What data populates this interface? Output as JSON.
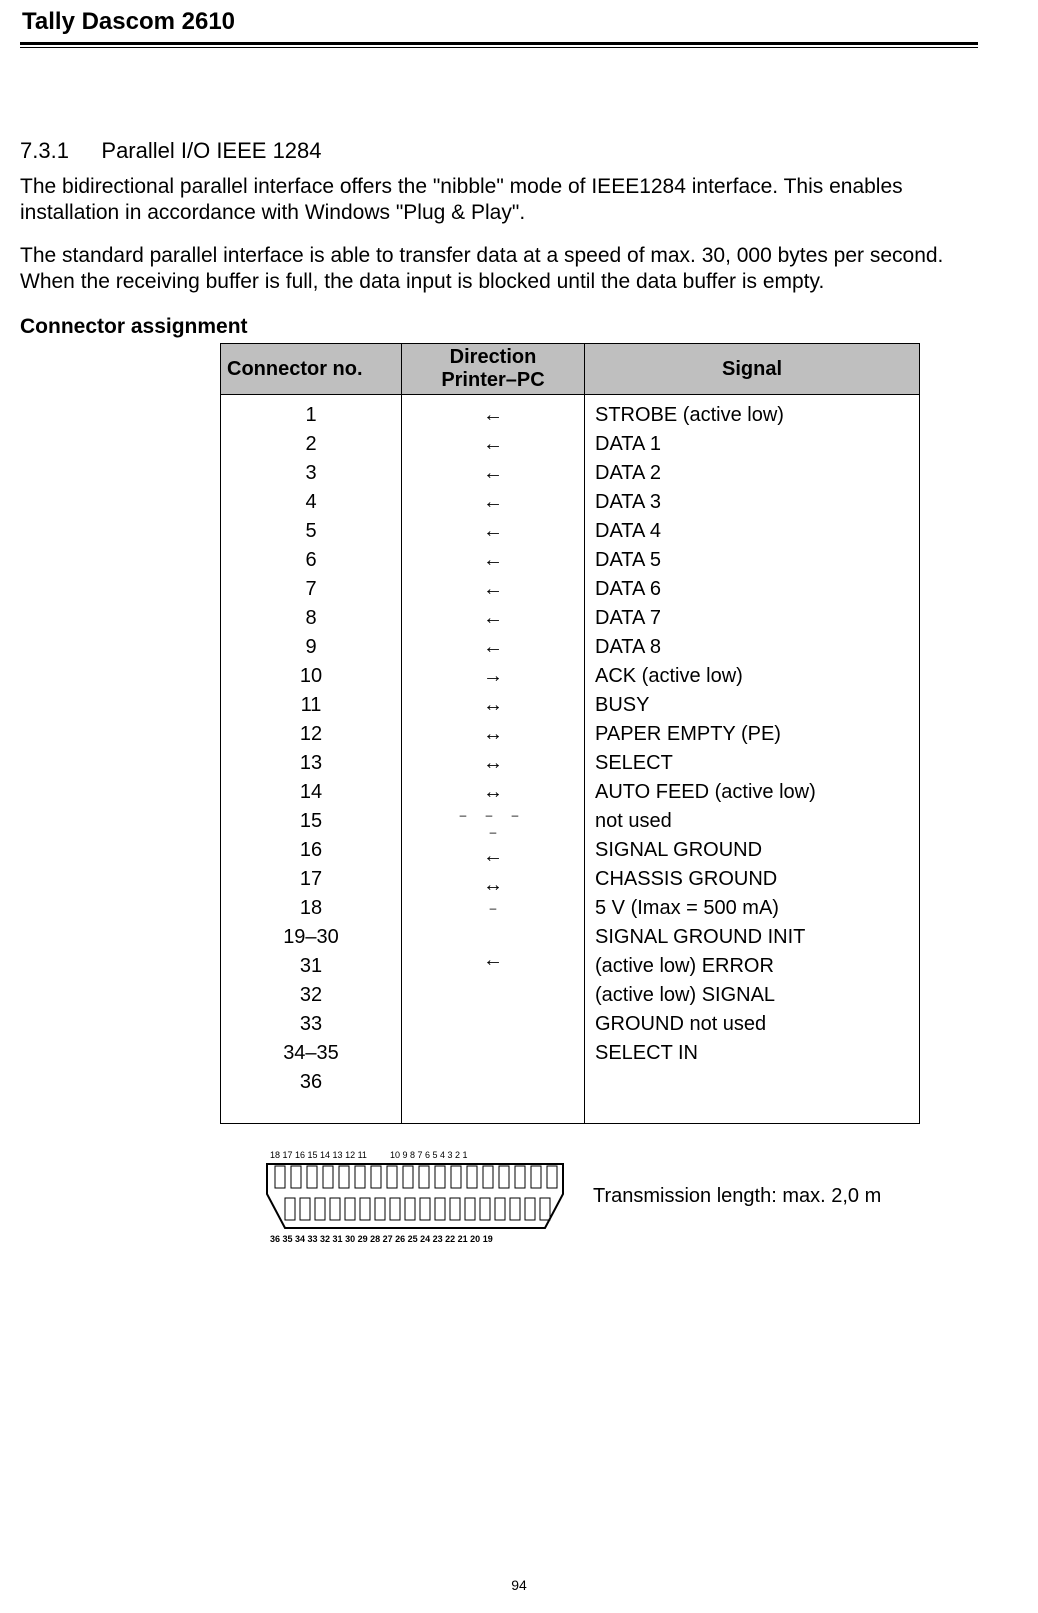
{
  "header": {
    "title": "Tally Dascom 2610"
  },
  "section": {
    "number": "7.3.1",
    "title": "Parallel I/O IEEE 1284"
  },
  "paragraphs": {
    "p1": "The bidirectional parallel interface offers the \"nibble\" mode of IEEE1284 interface. This enables installation in accordance with Windows \"Plug & Play\".",
    "p2": "The standard parallel interface is able to transfer data at a speed of max. 30, 000 bytes per second. When the receiving buffer is full, the data input is blocked until the data buffer is empty."
  },
  "subheading": "Connector assignment",
  "table": {
    "headers": {
      "no": "Connector no.",
      "dir1": "Direction",
      "dir2": "Printer–PC",
      "sig": "Signal"
    },
    "connector_no": "1\n2\n3\n4\n5\n6\n7\n8\n9\n10\n11\n12\n13\n14\n15\n16\n17\n18\n19–30\n31\n32\n33\n34–35\n36",
    "signals": "STROBE (active low)\nDATA 1\nDATA 2\nDATA 3\nDATA 4\nDATA 5\nDATA 6\nDATA 7\nDATA 8\nACK (active low)\nBUSY\nPAPER EMPTY (PE)\nSELECT\nAUTO FEED (active low)\nnot used\nSIGNAL GROUND\nCHASSIS GROUND\n5 V (Imax = 500 mA)\nSIGNAL GROUND INIT\n(active low) ERROR\n(active low) SIGNAL\nGROUND not used\nSELECT IN",
    "directions": {
      "d1": "←",
      "d2": "←",
      "d3": "←",
      "d4": "←",
      "d5": "←",
      "d6": "←",
      "d7": "←",
      "d8": "←",
      "d9": "←",
      "d10": "→",
      "d11": "↔",
      "d12": "↔",
      "d13": "↔",
      "d14": "↔",
      "d15": "–  –  –",
      "d16": "–",
      "d17": "←",
      "d18": "↔",
      "d19": "–",
      "d20": "←"
    }
  },
  "diagram": {
    "top_labels": "18 17 16 15 14 13 12 11 10  9   8   7   6   5   4   3   2   1",
    "bottom_labels": "36 35 34 33 32 31 30 29 28 27 26 25 24 23 22 21 20 19"
  },
  "transmission": "Transmission length: max. 2,0 m",
  "page_number": "94"
}
